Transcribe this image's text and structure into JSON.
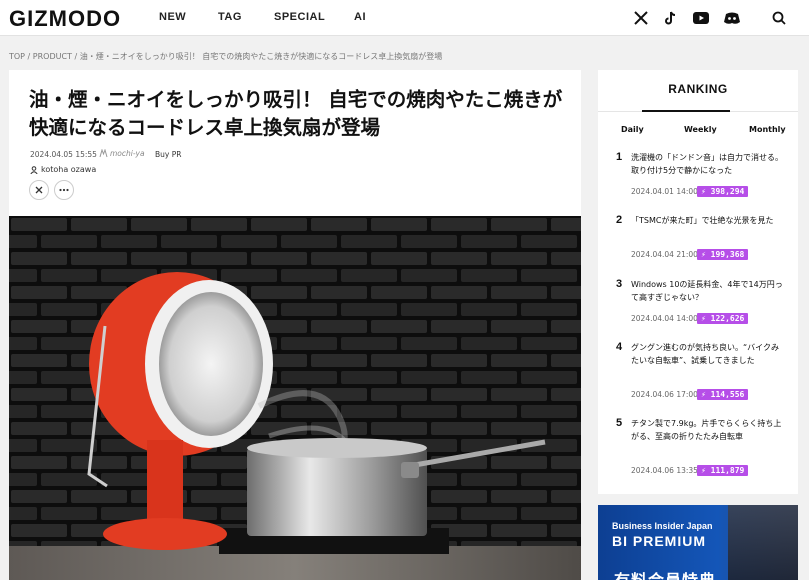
{
  "header": {
    "logo": "GIZMODO",
    "nav": [
      "NEW",
      "TAG",
      "SPECIAL",
      "AI"
    ],
    "social_icons": [
      "x-icon",
      "tiktok-icon",
      "youtube-icon",
      "discord-icon"
    ],
    "search_icon": "search-icon"
  },
  "breadcrumb": "TOP / PRODUCT / 油・煙・ニオイをしっかり吸引！ 自宅での焼肉やたこ焼きが快適になるコードレス卓上換気扇が登場",
  "article": {
    "title": "油・煙・ニオイをしっかり吸引！ 自宅での焼肉やたこ焼きが快適になるコードレス卓上換気扇が登場",
    "date": "2024.04.05 15:55",
    "sponsor": "mochi-ya",
    "buy_label": "Buy PR",
    "author": "kotoha ozawa"
  },
  "ranking": {
    "title": "RANKING",
    "tabs": [
      "Daily",
      "Weekly",
      "Monthly"
    ],
    "active_tab": "Weekly",
    "items": [
      {
        "rank": "1",
        "text": "洗濯機の「ドンドン音」は自力で消せる。取り付け5分で静かになった",
        "date": "2024.04.01 14:00",
        "views": "⚡ 398,294"
      },
      {
        "rank": "2",
        "text": "「TSMCが来た町」で壮絶な光景を見た",
        "date": "2024.04.04 21:00",
        "views": "⚡ 199,368"
      },
      {
        "rank": "3",
        "text": "Windows 10の延長料金、4年で14万円って高すぎじゃない？",
        "date": "2024.04.04 14:00",
        "views": "⚡ 122,626"
      },
      {
        "rank": "4",
        "text": "グングン進むのが気持ち良い。“バイクみたいな自転車”、試乗してきました",
        "date": "2024.04.06 17:00",
        "views": "⚡ 114,556"
      },
      {
        "rank": "5",
        "text": "チタン製で7.9kg。片手でらくらく持ち上がる、至高の折りたたみ自転車",
        "date": "2024.04.06 13:35",
        "views": "⚡ 111,879"
      }
    ]
  },
  "ad": {
    "subtitle": "Business Insider Japan",
    "title": "BI PREMIUM",
    "bottom": "有料会員特典"
  },
  "colors": {
    "accent": "#b64ee8",
    "ad_blue": "#1456b8",
    "fan_red": "#e23c22"
  }
}
